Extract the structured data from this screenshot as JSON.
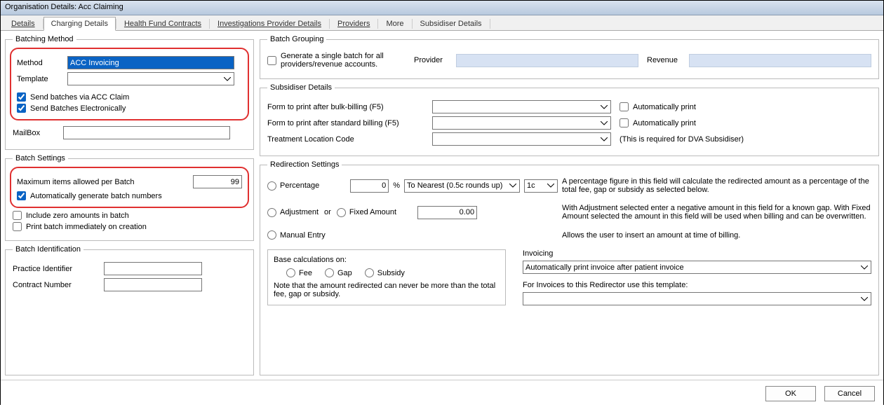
{
  "window": {
    "title": "Organisation Details: Acc Claiming"
  },
  "tabs": {
    "details": "Details",
    "charging": "Charging Details",
    "healthfund": "Health Fund Contracts",
    "investigations": "Investigations Provider Details",
    "providers": "Providers",
    "more": "More",
    "subsidiser": "Subsidiser Details"
  },
  "batching": {
    "legend": "Batching Method",
    "method_label": "Method",
    "method_value": "ACC Invoicing",
    "template_label": "Template",
    "send_via_acc": "Send batches via ACC Claim",
    "send_electronically": "Send Batches Electronically",
    "mailbox_label": "MailBox"
  },
  "batch_settings": {
    "legend": "Batch Settings",
    "max_items_label": "Maximum items allowed per Batch",
    "max_items_value": "99",
    "auto_generate": "Automatically generate batch numbers",
    "include_zero": "Include zero amounts in batch",
    "print_immediately": "Print batch immediately on creation"
  },
  "batch_id": {
    "legend": "Batch Identification",
    "practice_identifier": "Practice Identifier",
    "contract_number": "Contract Number"
  },
  "batch_grouping": {
    "legend": "Batch Grouping",
    "single_batch": "Generate a single batch for all providers/revenue accounts.",
    "provider_label": "Provider",
    "revenue_label": "Revenue"
  },
  "subsidiser": {
    "legend": "Subsidiser Details",
    "form_bulk": "Form to print after bulk-billing (F5)",
    "form_standard": "Form to print after standard billing (F5)",
    "treatment_loc": "Treatment Location Code",
    "auto_print": "Automatically print",
    "dva_note": "(This is required for DVA Subsidiser)"
  },
  "redirection": {
    "legend": "Redirection Settings",
    "percentage": "Percentage",
    "percentage_value": "0",
    "percent_sign": "%",
    "rounding": "To Nearest (0.5c rounds up)",
    "round_unit": "1c",
    "pct_help": "A percentage figure in this field will calculate the redirected amount as a percentage of the total fee, gap or subsidy as selected below.",
    "adjustment": "Adjustment",
    "or": "or",
    "fixed": "Fixed Amount",
    "fixed_value": "0.00",
    "adj_help": "With Adjustment selected enter a negative amount in this field for a known gap. With Fixed Amount selected the amount in this field will be used when billing and can be overwritten.",
    "manual": "Manual Entry",
    "manual_help": "Allows the user to insert an amount at time of billing.",
    "base_on": "Base calculations on:",
    "fee": "Fee",
    "gap": "Gap",
    "subsidy": "Subsidy",
    "note": "Note that the amount redirected can never be more than the total fee, gap or subsidy.",
    "invoicing_label": "Invoicing",
    "invoicing_value": "Automatically print invoice after patient invoice",
    "template_note": "For Invoices to this Redirector use this template:"
  },
  "buttons": {
    "ok": "OK",
    "cancel": "Cancel"
  }
}
